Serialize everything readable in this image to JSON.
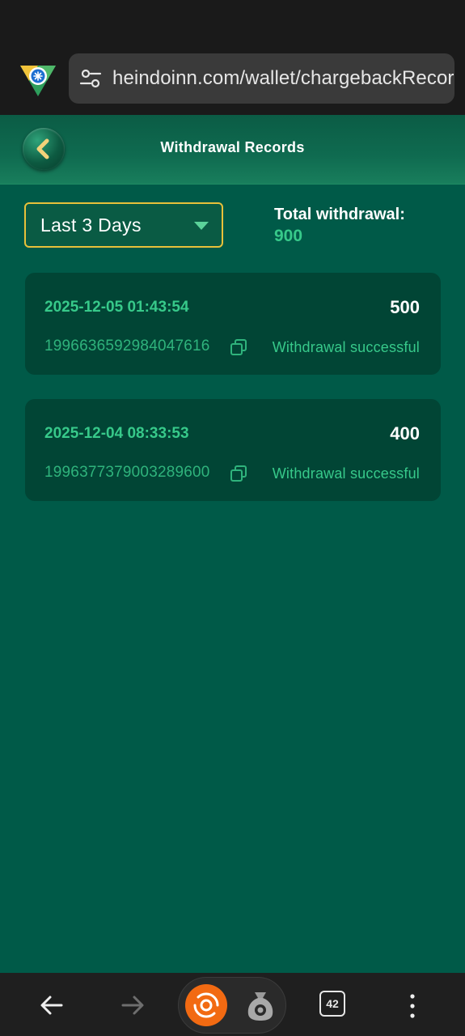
{
  "browser": {
    "url": "heindoinn.com/wallet/chargebackRecord",
    "tab_count": "42",
    "icons": {
      "logo": "browser-logo-icon",
      "site_settings": "tune-icon",
      "back": "arrow-left-icon",
      "forward": "arrow-right-icon",
      "brand": "brand-logo-icon",
      "wallet": "wallet-bag-icon",
      "menu": "more-vertical-icon"
    }
  },
  "header": {
    "title": "Withdrawal Records",
    "back_icon": "chevron-left-icon"
  },
  "filter": {
    "selected_range": "Last 3 Days",
    "total_label": "Total withdrawal:",
    "total_value": "900"
  },
  "records": [
    {
      "date": "2025-12-05 01:43:54",
      "amount": "500",
      "order_id": "1996636592984047616",
      "status": "Withdrawal successful"
    },
    {
      "date": "2025-12-04 08:33:53",
      "amount": "400",
      "order_id": "1996377379003289600",
      "status": "Withdrawal successful"
    }
  ],
  "colors": {
    "page_bg": "#005a48",
    "card_bg": "#014535",
    "accent_green": "#37c98a",
    "select_border": "#e8c13a"
  }
}
